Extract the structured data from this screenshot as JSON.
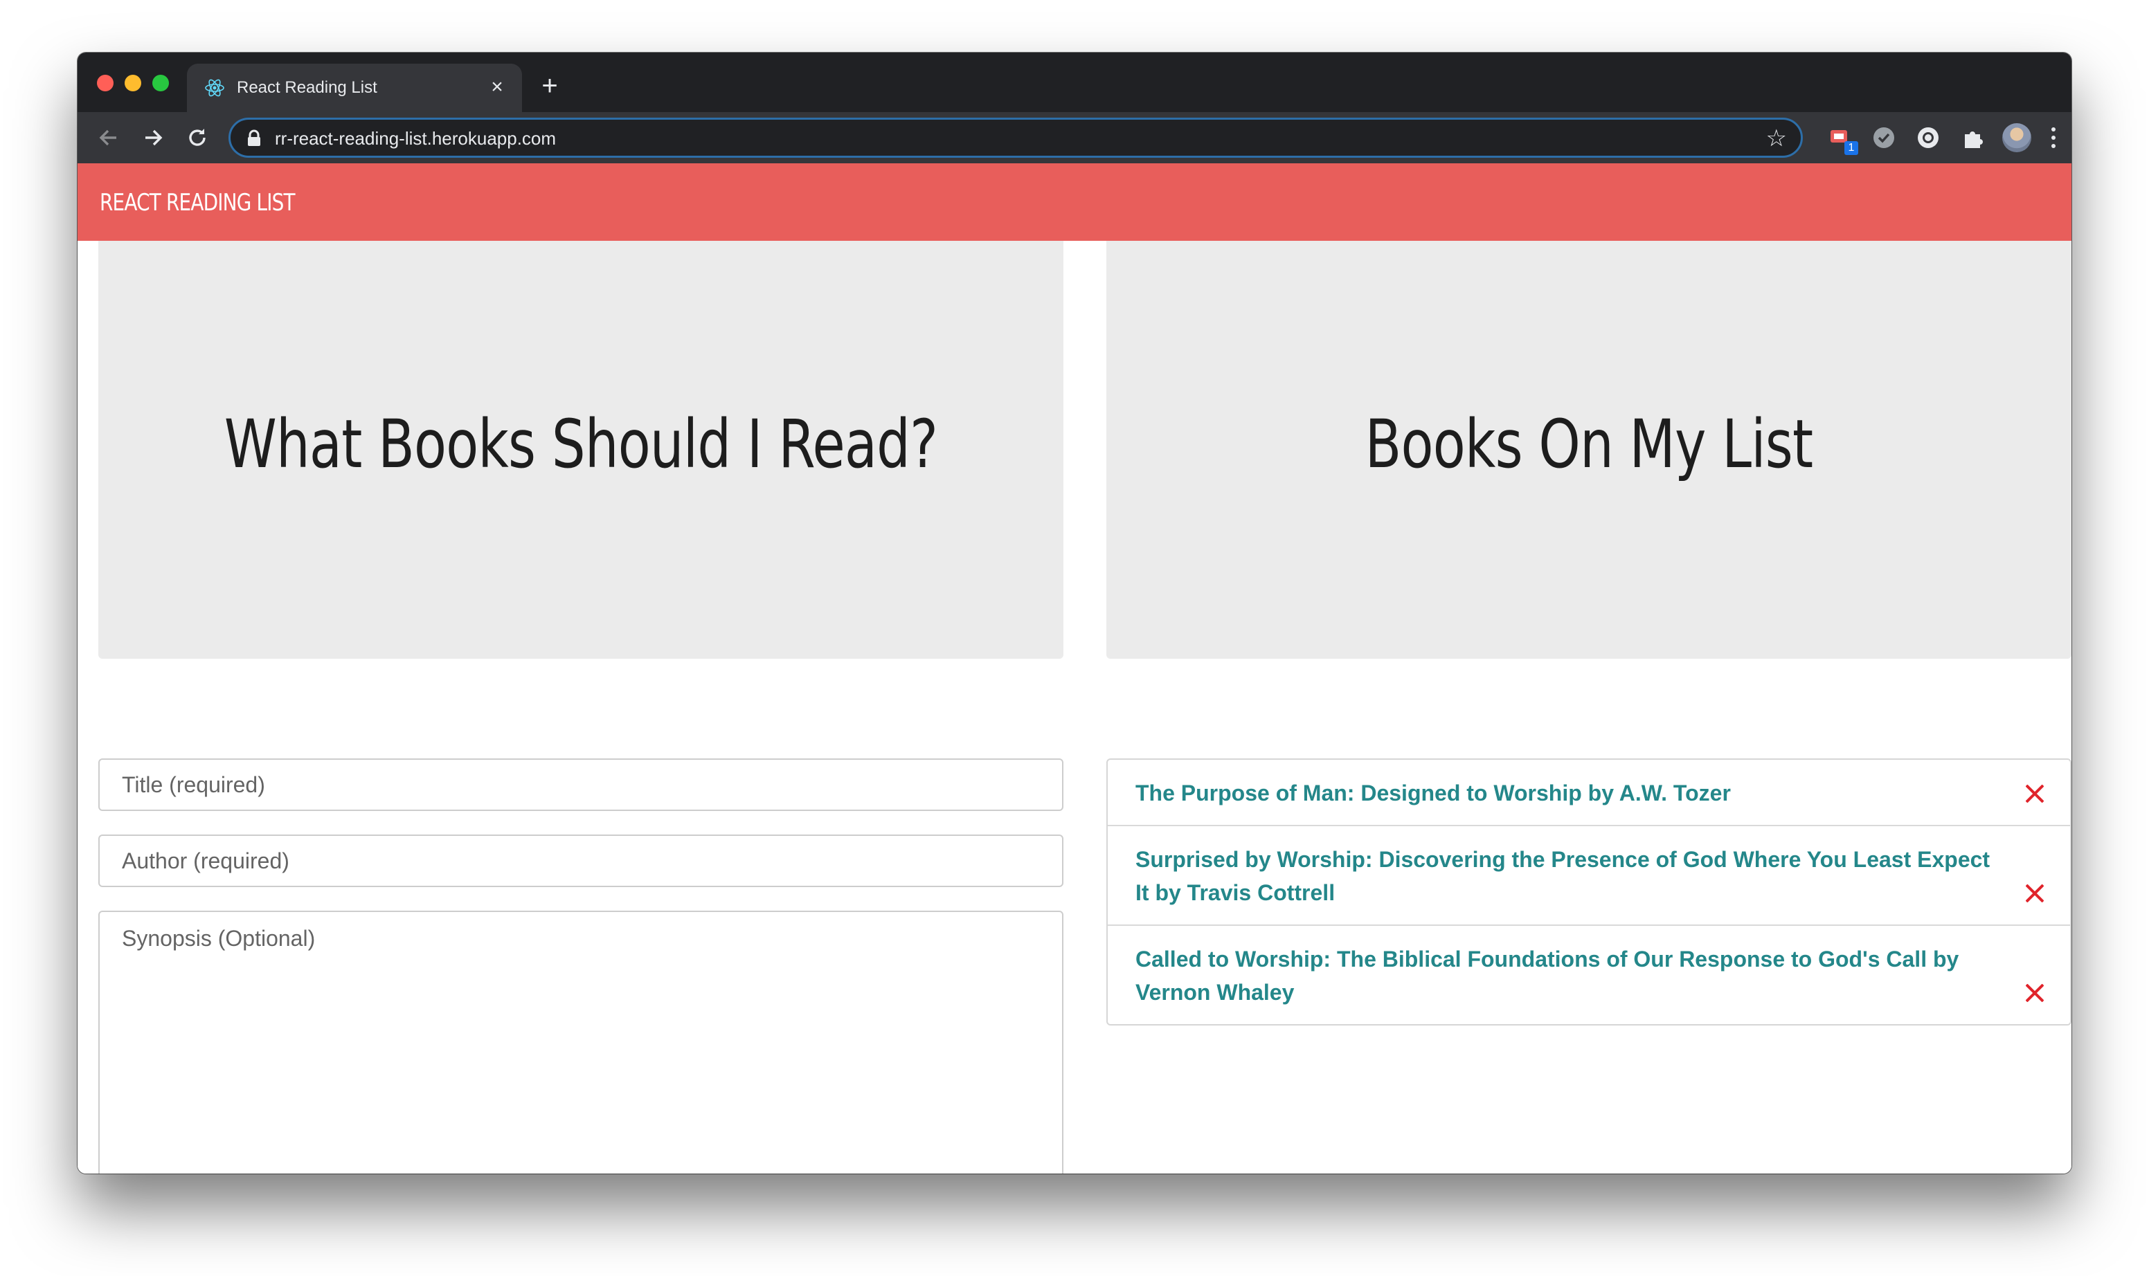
{
  "browser": {
    "tab_title": "React Reading List",
    "tab_close_symbol": "×",
    "new_tab_symbol": "+",
    "url": "rr-react-reading-list.herokuapp.com",
    "extension_badge": "1"
  },
  "navbar": {
    "brand": "REACT READING LIST",
    "color": "#e85e5b"
  },
  "left_panel": {
    "heading": "What Books Should I Read?",
    "title_placeholder": "Title (required)",
    "author_placeholder": "Author (required)",
    "synopsis_placeholder": "Synopsis (Optional)"
  },
  "right_panel": {
    "heading": "Books On My List",
    "books": [
      {
        "text": "The Purpose of Man: Designed to Worship by A.W. Tozer"
      },
      {
        "text": "Surprised by Worship: Discovering the Presence of God Where You Least Expect It by Travis Cottrell"
      },
      {
        "text": "Called to Worship: The Biblical Foundations of Our Response to God's Call by Vernon Whaley"
      }
    ]
  },
  "colors": {
    "link": "#24878a",
    "remove": "#e0242b",
    "jumbotron": "#ebebeb"
  }
}
